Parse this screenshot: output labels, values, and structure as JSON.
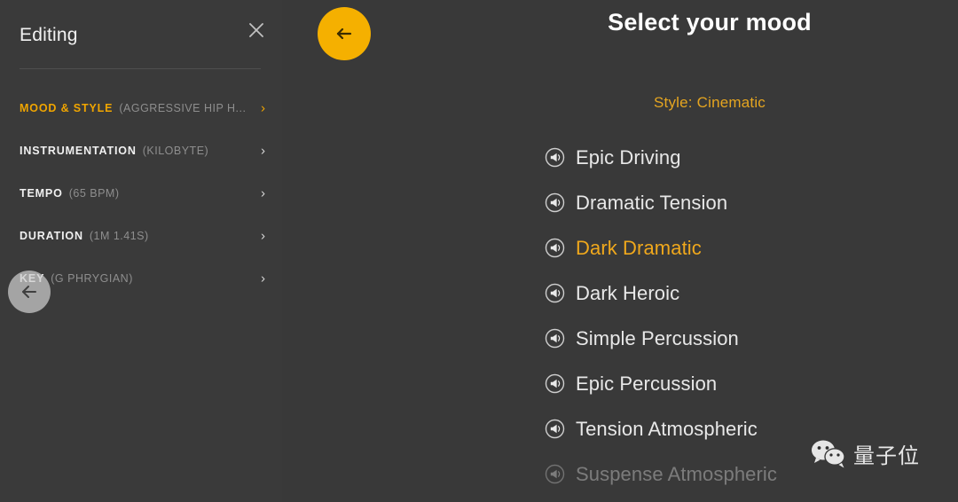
{
  "editing_panel": {
    "title": "Editing",
    "close_icon": "close-icon",
    "params": [
      {
        "label": "MOOD & STYLE",
        "value": "(AGGRESSIVE HIP H...",
        "active": true,
        "chevron": "›"
      },
      {
        "label": "INSTRUMENTATION",
        "value": "(KILOBYTE)",
        "active": false,
        "chevron": "›"
      },
      {
        "label": "TEMPO",
        "value": "(65 BPM)",
        "active": false,
        "chevron": "›"
      },
      {
        "label": "DURATION",
        "value": "(1M 1.41S)",
        "active": false,
        "chevron": "›"
      },
      {
        "label": "KEY",
        "value": "(G PHRYGIAN)",
        "active": false,
        "chevron": "›"
      }
    ],
    "gray_back_icon": "arrow-left-icon"
  },
  "orange_back_button": {
    "icon": "arrow-left-icon",
    "color": "#f5b000"
  },
  "mood_panel": {
    "title": "Select your mood",
    "style_label": "Style: Cinematic",
    "items": [
      {
        "label": "Epic Driving",
        "icon": "speaker-icon",
        "selected": false,
        "dimmed": false
      },
      {
        "label": "Dramatic Tension",
        "icon": "speaker-icon",
        "selected": false,
        "dimmed": false
      },
      {
        "label": "Dark Dramatic",
        "icon": "speaker-icon",
        "selected": true,
        "dimmed": false
      },
      {
        "label": "Dark Heroic",
        "icon": "speaker-icon",
        "selected": false,
        "dimmed": false
      },
      {
        "label": "Simple Percussion",
        "icon": "speaker-icon",
        "selected": false,
        "dimmed": false
      },
      {
        "label": "Epic Percussion",
        "icon": "speaker-icon",
        "selected": false,
        "dimmed": false
      },
      {
        "label": "Tension Atmospheric",
        "icon": "speaker-icon",
        "selected": false,
        "dimmed": false
      },
      {
        "label": "Suspense Atmospheric",
        "icon": "speaker-icon",
        "selected": false,
        "dimmed": true
      }
    ]
  },
  "watermark": {
    "logo_icon": "wechat-icon",
    "text": "量子位"
  },
  "colors": {
    "background": "#3a3a3a",
    "accent_orange": "#f0a500",
    "accent_button": "#f5b000",
    "text_primary": "#f0f0f0",
    "text_muted": "#8e8e8e"
  }
}
